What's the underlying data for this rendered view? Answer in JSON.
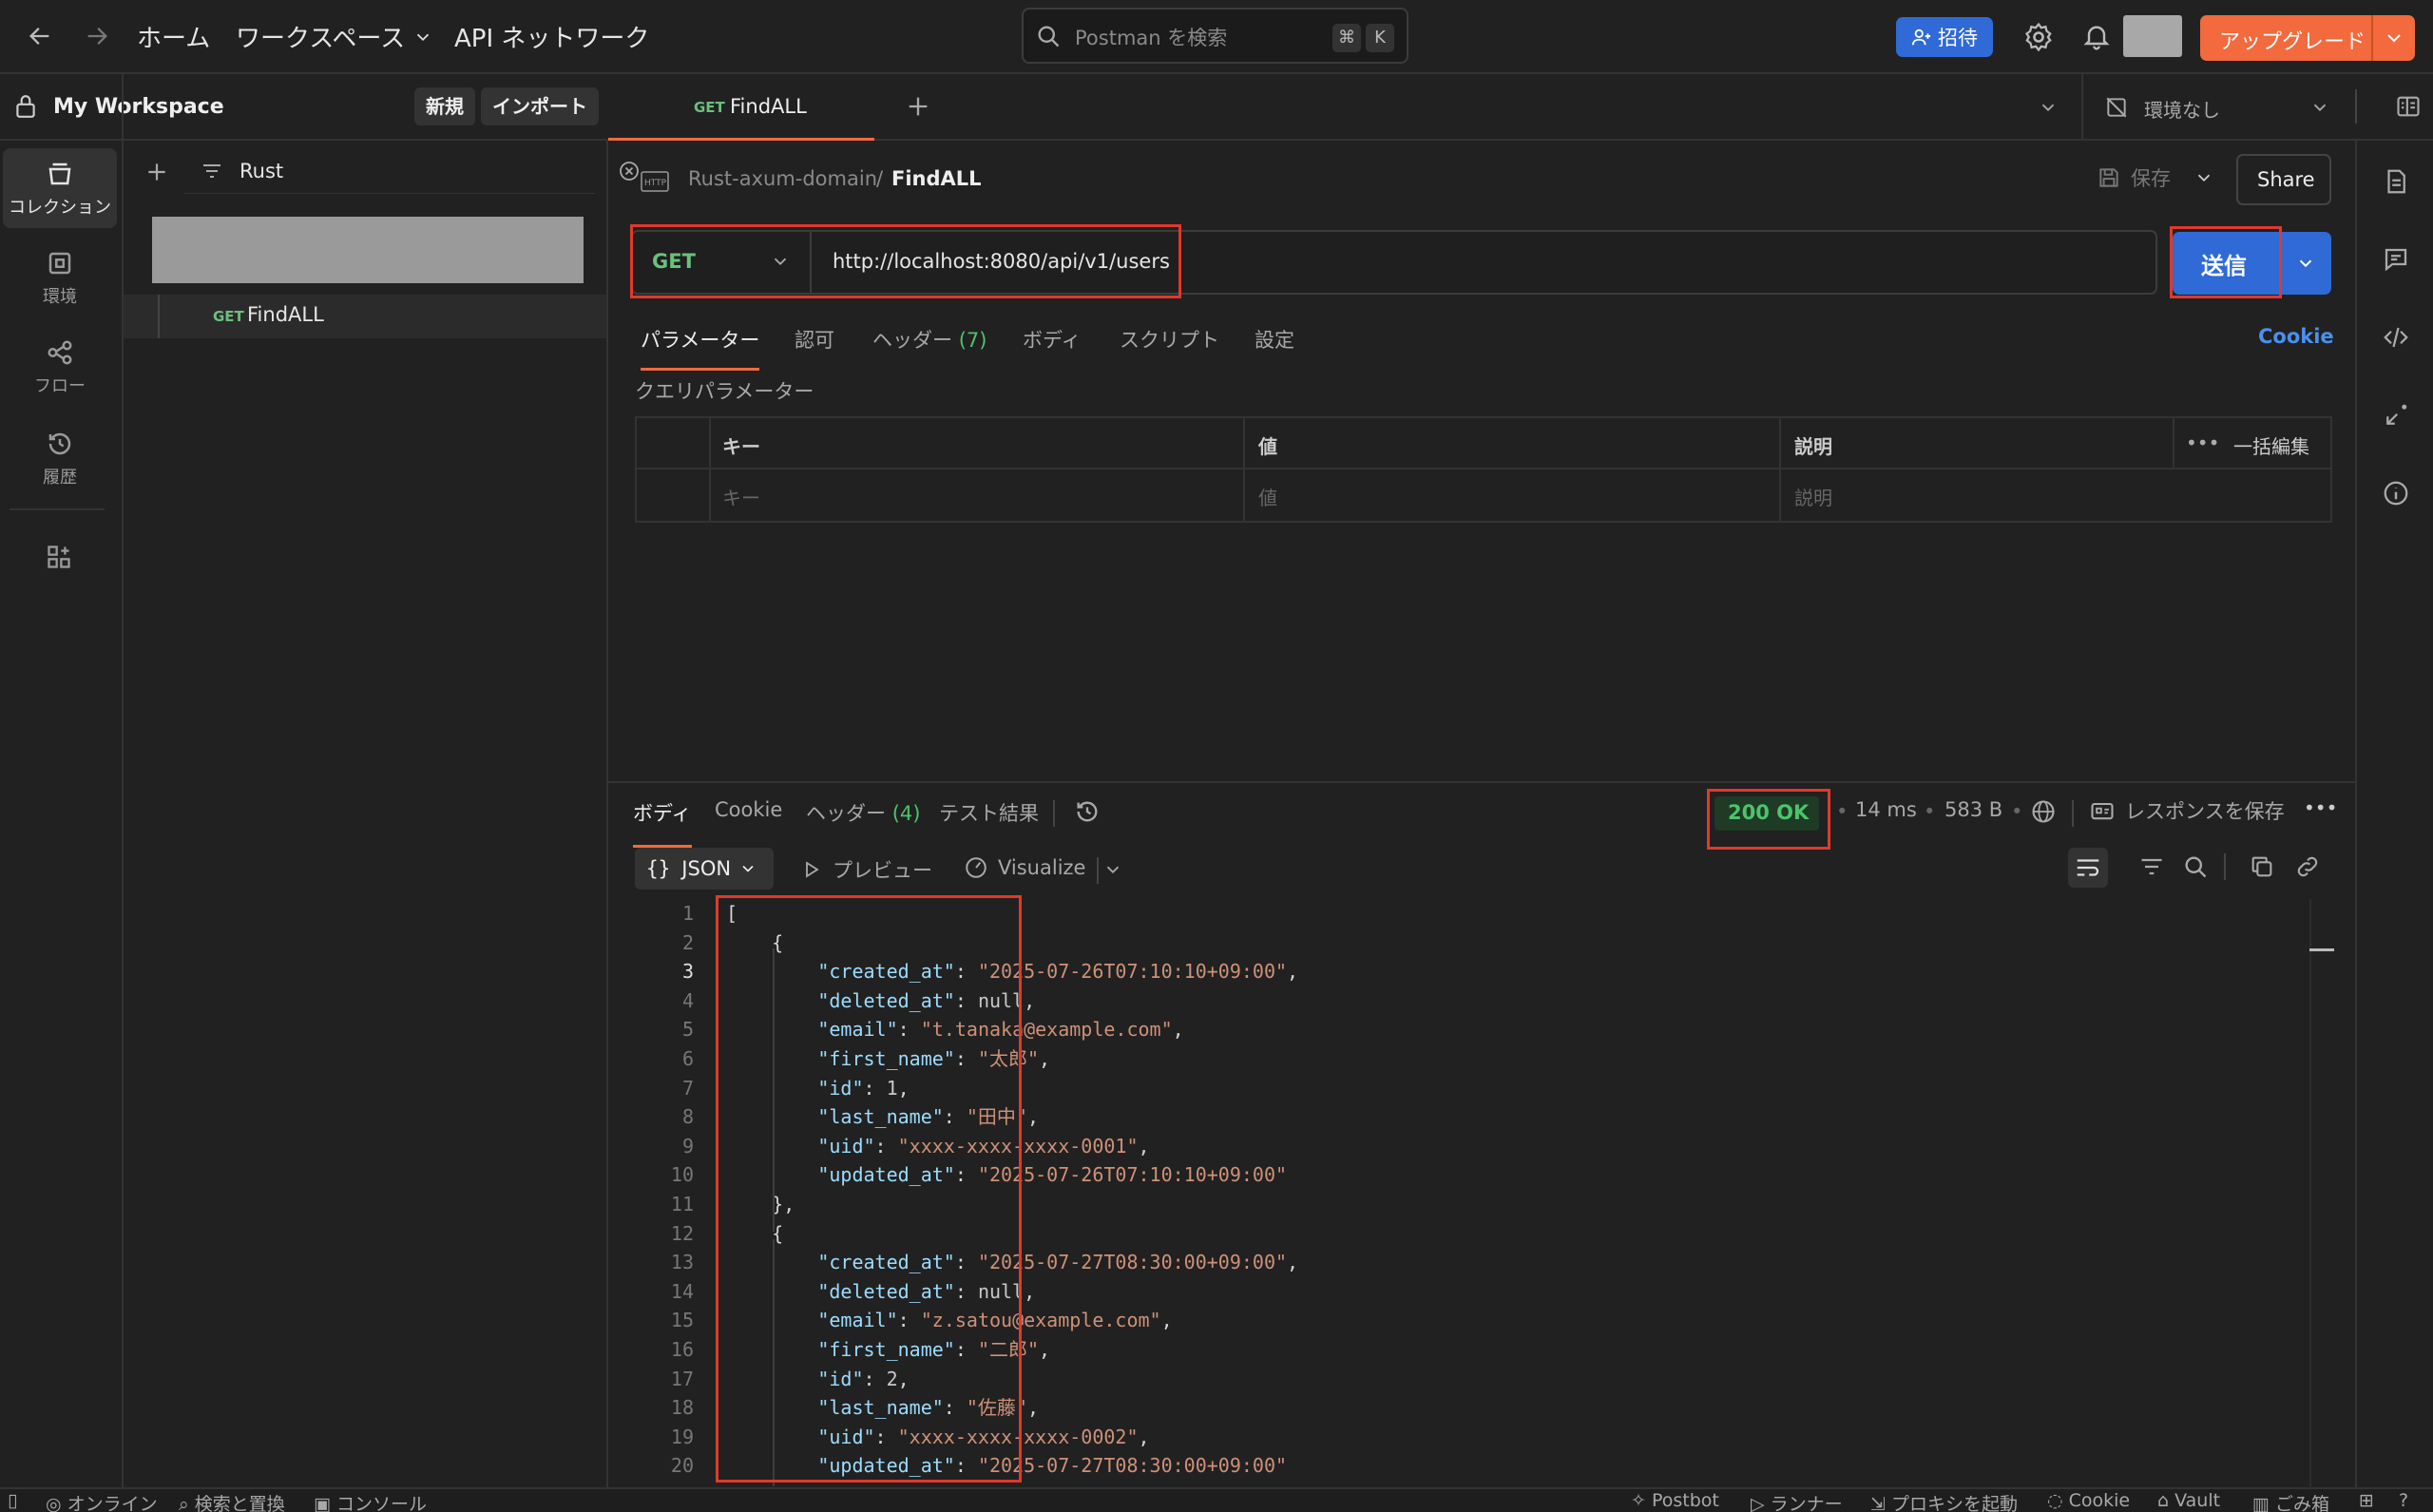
{
  "topbar": {
    "home": "ホーム",
    "workspaces": "ワークスペース",
    "api_network": "API ネットワーク",
    "search_placeholder": "Postman を検索",
    "kbd_cmd": "⌘",
    "kbd_k": "K",
    "invite": "招待",
    "upgrade": "アップグレード"
  },
  "workspace": {
    "name": "My Workspace",
    "new": "新規",
    "import": "インポート"
  },
  "rail": {
    "items": [
      {
        "label": "コレクション",
        "icon": "collections-icon"
      },
      {
        "label": "環境",
        "icon": "environment-icon"
      },
      {
        "label": "フロー",
        "icon": "flows-icon"
      },
      {
        "label": "履歴",
        "icon": "history-icon"
      }
    ]
  },
  "sidebar": {
    "filter_value": "Rust",
    "request_method": "GET",
    "request_name": "FindALL"
  },
  "tabs": {
    "active_method": "GET",
    "active_name": "FindALL",
    "environment": "環境なし"
  },
  "request": {
    "collection": "Rust-axum-domain",
    "separator": "/",
    "name": "FindALL",
    "save": "保存",
    "share": "Share",
    "method": "GET",
    "url": "http://localhost:8080/api/v1/users",
    "send": "送信",
    "subtabs": [
      "パラメーター",
      "認可",
      "ヘッダー",
      "ボディ",
      "スクリプト",
      "設定"
    ],
    "headers_count": "(7)",
    "cookie": "Cookie",
    "query_title": "クエリパラメーター",
    "columns": {
      "key": "キー",
      "value": "値",
      "desc": "説明",
      "bulk": "一括編集"
    },
    "placeholders": {
      "key": "キー",
      "value": "値",
      "desc": "説明"
    }
  },
  "response": {
    "tabs": [
      "ボディ",
      "Cookie",
      "ヘッダー",
      "テスト結果"
    ],
    "headers_count": "(4)",
    "status": "200 OK",
    "time": "14 ms",
    "size": "583 B",
    "save_response": "レスポンスを保存",
    "format": "JSON",
    "preview": "プレビュー",
    "visualize": "Visualize",
    "lines": [
      {
        "n": "1",
        "indent": 0,
        "text": "["
      },
      {
        "n": "2",
        "indent": 1,
        "text": "{"
      },
      {
        "n": "3",
        "indent": 2,
        "key": "created_at",
        "val": "\"2025-07-26T07:10:10+09:00\"",
        "type": "s",
        "comma": ","
      },
      {
        "n": "4",
        "indent": 2,
        "key": "deleted_at",
        "val": "null",
        "type": "n",
        "comma": ","
      },
      {
        "n": "5",
        "indent": 2,
        "key": "email",
        "val": "\"t.tanaka@example.com\"",
        "type": "s",
        "comma": ","
      },
      {
        "n": "6",
        "indent": 2,
        "key": "first_name",
        "val": "\"太郎\"",
        "type": "s",
        "comma": ","
      },
      {
        "n": "7",
        "indent": 2,
        "key": "id",
        "val": "1",
        "type": "n",
        "comma": ","
      },
      {
        "n": "8",
        "indent": 2,
        "key": "last_name",
        "val": "\"田中\"",
        "type": "s",
        "comma": ","
      },
      {
        "n": "9",
        "indent": 2,
        "key": "uid",
        "val": "\"xxxx-xxxx-xxxx-0001\"",
        "type": "s",
        "comma": ","
      },
      {
        "n": "10",
        "indent": 2,
        "key": "updated_at",
        "val": "\"2025-07-26T07:10:10+09:00\"",
        "type": "s",
        "comma": ""
      },
      {
        "n": "11",
        "indent": 1,
        "text": "},"
      },
      {
        "n": "12",
        "indent": 1,
        "text": "{"
      },
      {
        "n": "13",
        "indent": 2,
        "key": "created_at",
        "val": "\"2025-07-27T08:30:00+09:00\"",
        "type": "s",
        "comma": ","
      },
      {
        "n": "14",
        "indent": 2,
        "key": "deleted_at",
        "val": "null",
        "type": "n",
        "comma": ","
      },
      {
        "n": "15",
        "indent": 2,
        "key": "email",
        "val": "\"z.satou@example.com\"",
        "type": "s",
        "comma": ","
      },
      {
        "n": "16",
        "indent": 2,
        "key": "first_name",
        "val": "\"二郎\"",
        "type": "s",
        "comma": ","
      },
      {
        "n": "17",
        "indent": 2,
        "key": "id",
        "val": "2",
        "type": "n",
        "comma": ","
      },
      {
        "n": "18",
        "indent": 2,
        "key": "last_name",
        "val": "\"佐藤\"",
        "type": "s",
        "comma": ","
      },
      {
        "n": "19",
        "indent": 2,
        "key": "uid",
        "val": "\"xxxx-xxxx-xxxx-0002\"",
        "type": "s",
        "comma": ","
      },
      {
        "n": "20",
        "indent": 2,
        "key": "updated_at",
        "val": "\"2025-07-27T08:30:00+09:00\"",
        "type": "s",
        "comma": ""
      }
    ]
  },
  "statusbar": {
    "online": "オンライン",
    "find_replace": "検索と置換",
    "console": "コンソール",
    "postbot": "Postbot",
    "runner": "ランナー",
    "proxy": "プロキシを起動",
    "cookie": "Cookie",
    "vault": "Vault",
    "trash": "ごみ箱"
  },
  "colors": {
    "accent_orange": "#f26a3d",
    "send_blue": "#2f6ad6",
    "status_green": "#4cc36b",
    "highlight_red": "#e0392b"
  }
}
